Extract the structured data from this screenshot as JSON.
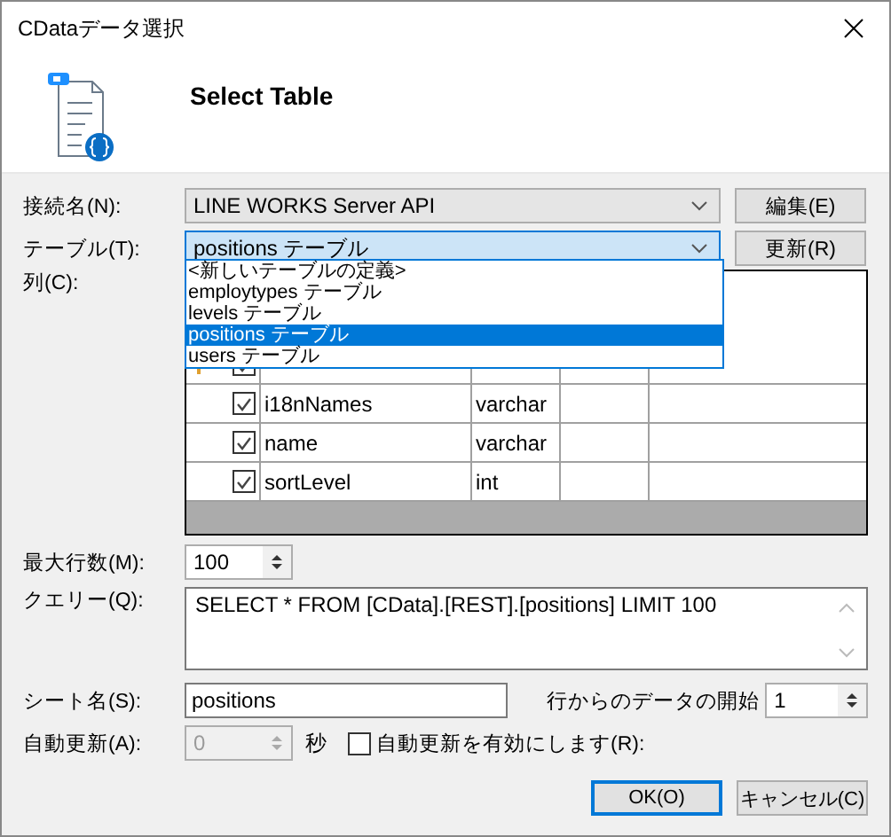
{
  "window": {
    "title": "CDataデータ選択"
  },
  "header": {
    "title": "Select Table"
  },
  "connection": {
    "label": "接続名(N):",
    "value": "LINE WORKS Server API",
    "button": "編集(E)"
  },
  "table": {
    "label": "テーブル(T):",
    "value": "positions テーブル",
    "button": "更新(R)",
    "expanded": true,
    "options": [
      {
        "label": "<新しいテーブルの定義>",
        "selected": false
      },
      {
        "label": "employtypes テーブル",
        "selected": false
      },
      {
        "label": "levels テーブル",
        "selected": false
      },
      {
        "label": "positions テーブル",
        "selected": true
      },
      {
        "label": "users テーブル",
        "selected": false
      }
    ]
  },
  "columns": {
    "label": "列(C):",
    "rows": [
      {
        "kind": "key",
        "checked": true
      },
      {
        "kind": "plain",
        "checked": true,
        "name": "i18nNames",
        "type": "varchar"
      },
      {
        "kind": "plain",
        "checked": true,
        "name": "name",
        "type": "varchar"
      },
      {
        "kind": "plain",
        "checked": true,
        "name": "sortLevel",
        "type": "int"
      }
    ]
  },
  "max_rows": {
    "label": "最大行数(M):",
    "value": "100"
  },
  "query": {
    "label": "クエリー(Q):",
    "value": "SELECT * FROM [CData].[REST].[positions] LIMIT 100"
  },
  "sheet": {
    "label": "シート名(S):",
    "value": "positions"
  },
  "start_row": {
    "label": "行からのデータの開始",
    "value": "1"
  },
  "auto_refresh": {
    "label": "自動更新(A):",
    "value": "0",
    "disabled": true,
    "unit": "秒",
    "enable": {
      "label": "自動更新を有効にします(R):",
      "checked": false
    }
  },
  "buttons": [
    {
      "label": "OK(O)",
      "default": true
    },
    {
      "label": "キャンセル(C)",
      "default": false
    }
  ]
}
